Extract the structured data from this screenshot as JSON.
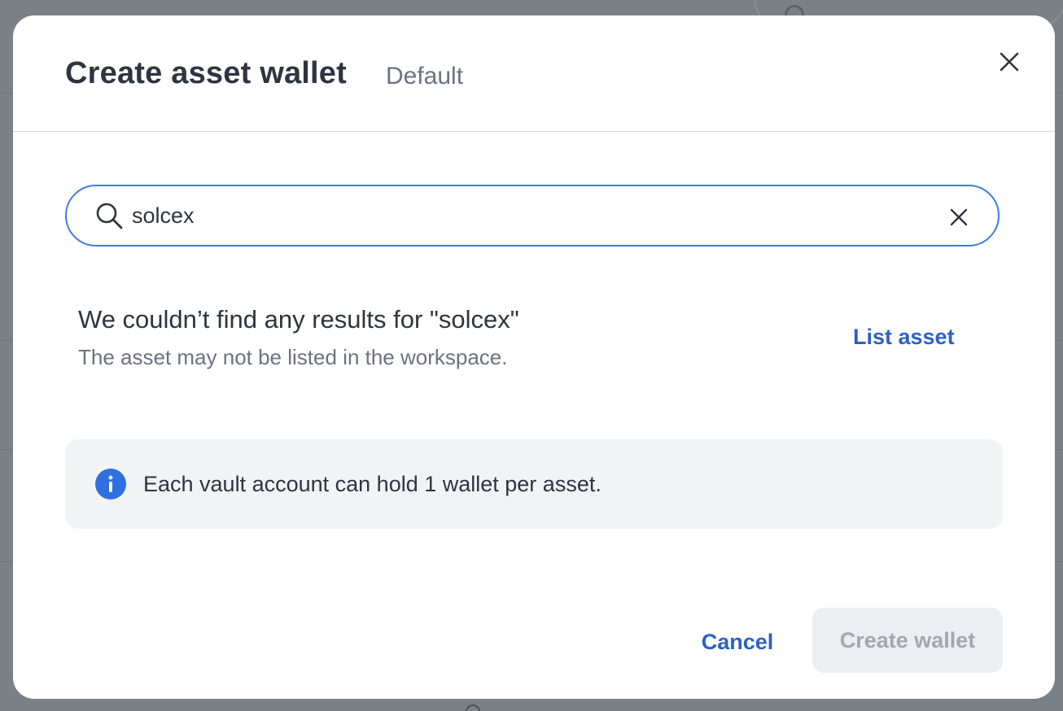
{
  "dialog": {
    "title": "Create asset wallet",
    "subtitle": "Default",
    "close_icon": "close-icon"
  },
  "search": {
    "value": "solcex",
    "icon": "search-icon",
    "clear_icon": "clear-icon",
    "focused": true
  },
  "results": {
    "empty_title": "We couldn’t find any results for \"solcex\"",
    "empty_subtitle": "The asset may not be listed in the workspace.",
    "list_asset_label": "List asset"
  },
  "info": {
    "icon": "info-icon",
    "text": "Each vault account can hold 1 wallet per asset."
  },
  "footer": {
    "cancel_label": "Cancel",
    "create_label": "Create wallet",
    "create_disabled": true
  },
  "colors": {
    "accent": "#2a62c5",
    "focus_border": "#3f7be0",
    "info_icon": "#2f6fe0",
    "overlay": "#7b7f86"
  }
}
